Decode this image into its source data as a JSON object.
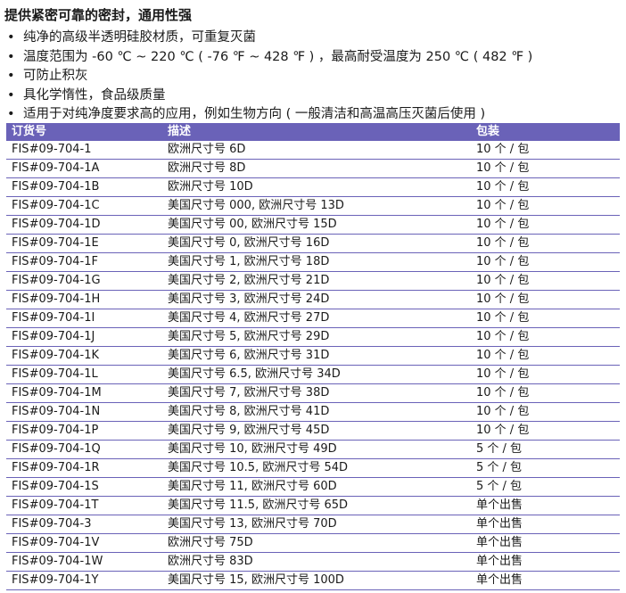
{
  "title": "提供紧密可靠的密封，通用性强",
  "bullets": [
    "纯净的高级半透明硅胶材质，可重复灭菌",
    "温度范围为 -60 ℃ ~ 220 ℃ ( -76 ℉ ~ 428 ℉ ) ，最高耐受温度为 250 ℃ ( 482 ℉ )",
    "可防止积灰",
    "具化学惰性，食品级质量",
    "适用于对纯净度要求高的应用，例如生物方向 ( 一般清洁和高温高压灭菌后使用 )"
  ],
  "table": {
    "headers": [
      "订货号",
      "描述",
      "包装"
    ],
    "rows": [
      [
        "FIS#09-704-1",
        "欧洲尺寸号 6D",
        "10 个 / 包"
      ],
      [
        "FIS#09-704-1A",
        "欧洲尺寸号 8D",
        "10 个 / 包"
      ],
      [
        "FIS#09-704-1B",
        "欧洲尺寸号 10D",
        "10 个 / 包"
      ],
      [
        "FIS#09-704-1C",
        "美国尺寸号 000, 欧洲尺寸号 13D",
        "10 个 / 包"
      ],
      [
        "FIS#09-704-1D",
        "美国尺寸号 00, 欧洲尺寸号 15D",
        "10 个 / 包"
      ],
      [
        "FIS#09-704-1E",
        "美国尺寸号 0, 欧洲尺寸号 16D",
        "10 个 / 包"
      ],
      [
        "FIS#09-704-1F",
        "美国尺寸号 1, 欧洲尺寸号 18D",
        "10 个 / 包"
      ],
      [
        "FIS#09-704-1G",
        "美国尺寸号 2, 欧洲尺寸号 21D",
        "10 个 / 包"
      ],
      [
        "FIS#09-704-1H",
        "美国尺寸号 3, 欧洲尺寸号 24D",
        "10 个 / 包"
      ],
      [
        "FIS#09-704-1I",
        "美国尺寸号 4, 欧洲尺寸号 27D",
        "10 个 / 包"
      ],
      [
        "FIS#09-704-1J",
        "美国尺寸号 5, 欧洲尺寸号 29D",
        "10 个 / 包"
      ],
      [
        "FIS#09-704-1K",
        "美国尺寸号 6, 欧洲尺寸号 31D",
        "10 个 / 包"
      ],
      [
        "FIS#09-704-1L",
        "美国尺寸号 6.5, 欧洲尺寸号 34D",
        "10 个 / 包"
      ],
      [
        "FIS#09-704-1M",
        "美国尺寸号 7, 欧洲尺寸号 38D",
        "10 个 / 包"
      ],
      [
        "FIS#09-704-1N",
        "美国尺寸号 8, 欧洲尺寸号 41D",
        "10 个 / 包"
      ],
      [
        "FIS#09-704-1P",
        "美国尺寸号 9, 欧洲尺寸号 45D",
        "10 个 / 包"
      ],
      [
        "FIS#09-704-1Q",
        "美国尺寸号 10, 欧洲尺寸号 49D",
        "5 个 / 包"
      ],
      [
        "FIS#09-704-1R",
        "美国尺寸号 10.5, 欧洲尺寸号 54D",
        "5 个 / 包"
      ],
      [
        "FIS#09-704-1S",
        "美国尺寸号 11, 欧洲尺寸号 60D",
        "5 个 / 包"
      ],
      [
        "FIS#09-704-1T",
        "美国尺寸号 11.5, 欧洲尺寸号 65D",
        "单个出售"
      ],
      [
        "FIS#09-704-3",
        "美国尺寸号 13, 欧洲尺寸号 70D",
        "单个出售"
      ],
      [
        "FIS#09-704-1V",
        "欧洲尺寸号 75D",
        "单个出售"
      ],
      [
        "FIS#09-704-1W",
        "欧洲尺寸号 83D",
        "单个出售"
      ],
      [
        "FIS#09-704-1Y",
        "美国尺寸号 15, 欧洲尺寸号 100D",
        "单个出售"
      ]
    ]
  },
  "colors": {
    "header_bg": "#6a62b8",
    "header_text": "#ffffff",
    "row_border": "#6a62b8"
  }
}
